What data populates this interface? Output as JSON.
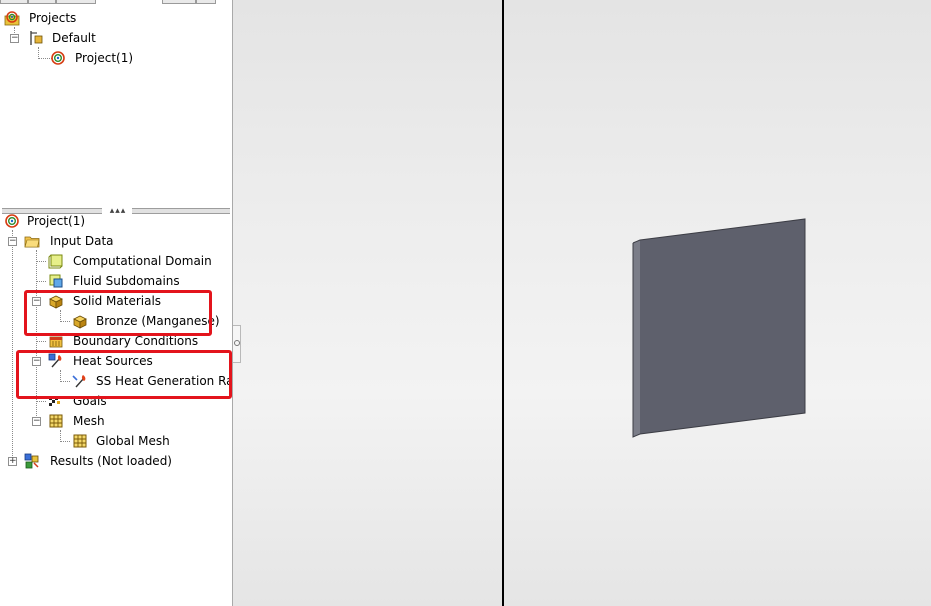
{
  "projects_tree": {
    "root": "Projects",
    "configuration": "Default",
    "project": "Project(1)"
  },
  "analysis_tree": {
    "root": "Project(1)",
    "input_data": "Input Data",
    "computational_domain": "Computational Domain",
    "fluid_subdomains": "Fluid Subdomains",
    "solid_materials": "Solid Materials",
    "solid_material_item": "Bronze (Manganese)",
    "boundary_conditions": "Boundary Conditions",
    "heat_sources": "Heat Sources",
    "heat_source_item": "SS Heat Generation Rate",
    "goals": "Goals",
    "mesh": "Mesh",
    "global_mesh": "Global Mesh",
    "results": "Results (Not loaded)"
  },
  "colors": {
    "highlight": "#e3141c",
    "plate_face": "#5e606c",
    "plate_edge": "#7b7d88",
    "viewport_bg": "#ececec"
  },
  "icons": {
    "projects": "project-rings-icon",
    "configuration": "configuration-icon",
    "project": "project-rings-icon",
    "input_data": "folder-icon",
    "computational_domain": "domain-box-icon",
    "fluid_subdomains": "fluid-subdomain-icon",
    "solid_materials": "solid-material-icon",
    "boundary_conditions": "boundary-condition-icon",
    "heat_sources": "heat-source-icon",
    "goals": "goals-flag-icon",
    "mesh": "mesh-grid-icon",
    "results": "results-icon"
  }
}
